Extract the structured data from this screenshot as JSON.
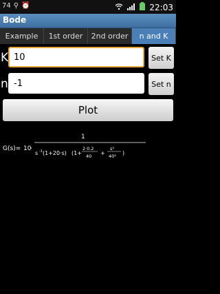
{
  "status_bar": {
    "left_text": "74",
    "time": "22:03",
    "icons": [
      "usb-icon",
      "alarm-icon",
      "wifi-icon",
      "signal-icon",
      "battery-icon"
    ]
  },
  "app": {
    "title": "Bode"
  },
  "tabs": [
    {
      "label": "Example",
      "active": false
    },
    {
      "label": "1st order",
      "active": false
    },
    {
      "label": "2nd order",
      "active": false
    },
    {
      "label": "n and K",
      "active": true
    }
  ],
  "k_row": {
    "label": "K",
    "value": "10",
    "button": "Set K"
  },
  "n_row": {
    "label": "n",
    "value": "-1",
    "button": "Set n"
  },
  "plot_button": "Plot",
  "formula": {
    "lhs": "G(s)=",
    "gain": "10",
    "dot": "·",
    "numerator": "1",
    "s_power_base": "s",
    "s_power_exp": "-1",
    "term1": "(1+20·s)",
    "term2_prefix": "(1+",
    "frac1_num": "2·0.2",
    "frac1_den": "40",
    "plus": "+",
    "frac2_num": "s²",
    "frac2_den": "40²",
    "term2_suffix": ")"
  },
  "colors": {
    "tab_active": "#4a7fb8",
    "title_bar": "#4a7fb8",
    "focus_border": "#e8a83a"
  }
}
